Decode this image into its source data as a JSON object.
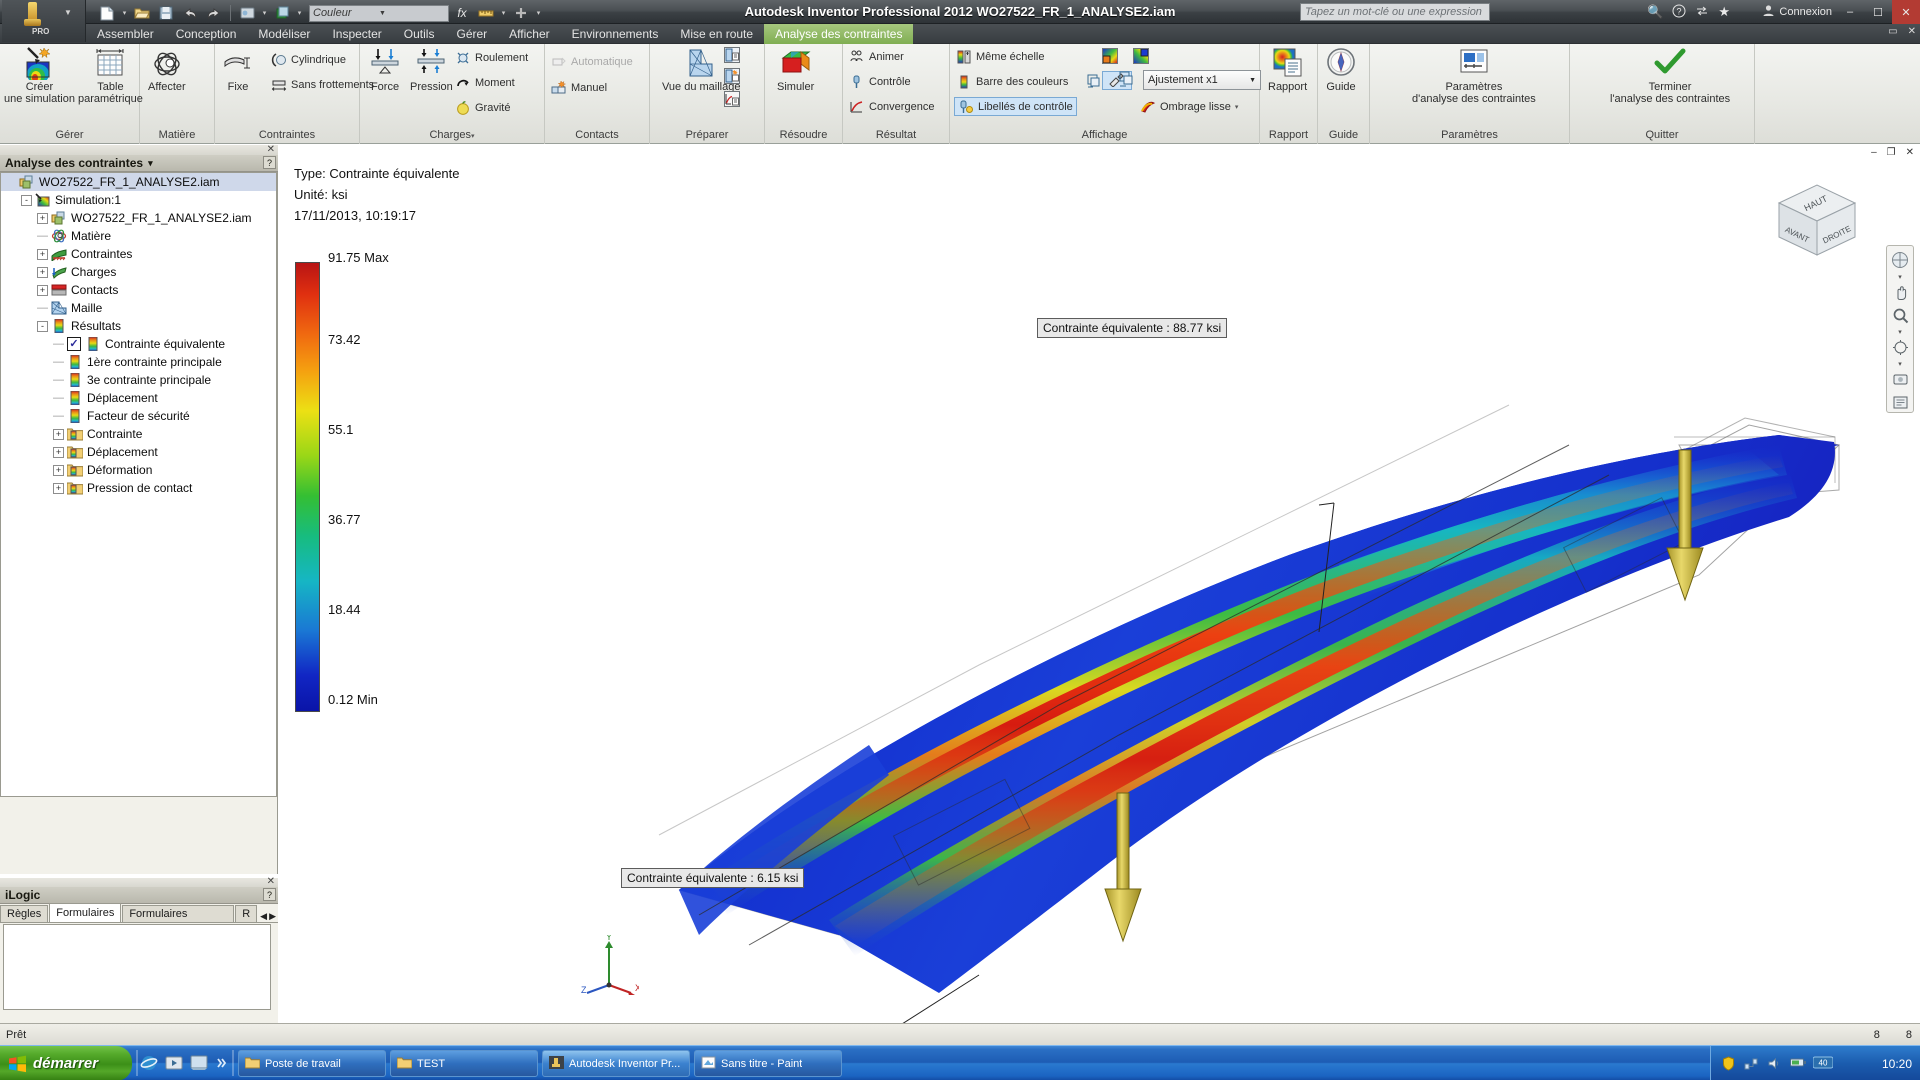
{
  "window": {
    "title": "Autodesk Inventor Professional 2012     WO27522_FR_1_ANALYSE2.iam",
    "search_placeholder": "Tapez un mot-clé ou une expression",
    "signin_label": "Connexion",
    "minimize": "–",
    "maximize": "☐",
    "close": "✕"
  },
  "quick_access": {
    "new_label": "new-file",
    "open_label": "open-file",
    "save_label": "save",
    "undo_label": "undo",
    "redo_label": "redo",
    "color_value": "Couleur",
    "fx_label": "fx",
    "arrow": "▾"
  },
  "tabs": [
    {
      "label": "Assembler",
      "active": false
    },
    {
      "label": "Conception",
      "active": false
    },
    {
      "label": "Modéliser",
      "active": false
    },
    {
      "label": "Inspecter",
      "active": false
    },
    {
      "label": "Outils",
      "active": false
    },
    {
      "label": "Gérer",
      "active": false
    },
    {
      "label": "Afficher",
      "active": false
    },
    {
      "label": "Environnements",
      "active": false
    },
    {
      "label": "Mise en route",
      "active": false
    },
    {
      "label": "Analyse des contraintes",
      "active": true
    }
  ],
  "ribbon": {
    "panels": [
      {
        "label": "Gérer"
      },
      {
        "label": "Matière"
      },
      {
        "label": "Contraintes"
      },
      {
        "label": "Charges"
      },
      {
        "label": "Contacts"
      },
      {
        "label": "Préparer"
      },
      {
        "label": "Résoudre"
      },
      {
        "label": "Résultat"
      },
      {
        "label": "Affichage"
      },
      {
        "label": "Rapport"
      },
      {
        "label": "Guide"
      },
      {
        "label": "Paramètres"
      },
      {
        "label": "Quitter"
      }
    ],
    "buttons": {
      "creer_simulation": "Créer\nune simulation",
      "table_parametrique": "Table\nparamétrique",
      "affecter": "Affecter",
      "fixe": "Fixe",
      "cylindrique": "Cylindrique",
      "sans_frottements": "Sans frottements",
      "force": "Force",
      "pression": "Pression",
      "roulement": "Roulement",
      "moment": "Moment",
      "gravite": "Gravité",
      "automatique": "Automatique",
      "manuel": "Manuel",
      "vue_maillage": "Vue du maillage",
      "simuler": "Simuler",
      "animer": "Animer",
      "controle": "Contrôle",
      "convergence": "Convergence",
      "meme_echelle": "Même échelle",
      "barre_couleurs": "Barre des couleurs",
      "libelles_controle": "Libellés de contrôle",
      "ombrage_lisse": "Ombrage lisse",
      "ajustement": "Ajustement x1",
      "rapport": "Rapport",
      "guide": "Guide",
      "parametres": "Paramètres\nd'analyse des contraintes",
      "terminer": "Terminer\nl'analyse des contraintes"
    },
    "charges_caret": "▾",
    "ombrage_caret": "▾"
  },
  "browser": {
    "title": "Analyse des contraintes",
    "title_caret": "▾",
    "help_glyph": "?",
    "close_glyph": "✕",
    "tree": [
      {
        "label": "WO27522_FR_1_ANALYSE2.iam",
        "depth": 0,
        "icon": "assembly-icon",
        "expander": "",
        "selected": true
      },
      {
        "label": "Simulation:1",
        "depth": 1,
        "icon": "simulation-icon",
        "expander": "-"
      },
      {
        "label": "WO27522_FR_1_ANALYSE2.iam",
        "depth": 2,
        "icon": "assembly-icon",
        "expander": "+"
      },
      {
        "label": "Matière",
        "depth": 2,
        "icon": "material-icon",
        "expander": ""
      },
      {
        "label": "Contraintes",
        "depth": 2,
        "icon": "constraints-icon",
        "expander": "+"
      },
      {
        "label": "Charges",
        "depth": 2,
        "icon": "loads-icon",
        "expander": "+"
      },
      {
        "label": "Contacts",
        "depth": 2,
        "icon": "contacts-icon",
        "expander": "+"
      },
      {
        "label": "Maille",
        "depth": 2,
        "icon": "mesh-icon",
        "expander": ""
      },
      {
        "label": "Résultats",
        "depth": 2,
        "icon": "results-icon",
        "expander": "-"
      },
      {
        "label": "Contrainte équivalente",
        "depth": 3,
        "icon": "result-bar-icon",
        "expander": "",
        "checked": true
      },
      {
        "label": "1ère contrainte principale",
        "depth": 3,
        "icon": "result-bar-icon",
        "expander": ""
      },
      {
        "label": "3e contrainte principale",
        "depth": 3,
        "icon": "result-bar-icon",
        "expander": ""
      },
      {
        "label": "Déplacement",
        "depth": 3,
        "icon": "result-bar-icon",
        "expander": ""
      },
      {
        "label": "Facteur de sécurité",
        "depth": 3,
        "icon": "result-bar-icon",
        "expander": ""
      },
      {
        "label": "Contrainte",
        "depth": 3,
        "icon": "folder-result-icon",
        "expander": "+"
      },
      {
        "label": "Déplacement",
        "depth": 3,
        "icon": "folder-result-icon",
        "expander": "+"
      },
      {
        "label": "Déformation",
        "depth": 3,
        "icon": "folder-result-icon",
        "expander": "+"
      },
      {
        "label": "Pression de contact",
        "depth": 3,
        "icon": "folder-result-icon",
        "expander": "+"
      }
    ]
  },
  "ilogic": {
    "title": "iLogic",
    "help_glyph": "?",
    "close_glyph": "✕",
    "tabs": [
      {
        "label": "Règles",
        "active": false
      },
      {
        "label": "Formulaires",
        "active": true
      },
      {
        "label": "Formulaires globaux",
        "active": false
      },
      {
        "label": "R",
        "active": false
      }
    ],
    "nav_prev": "◀",
    "nav_next": "▶"
  },
  "viewport": {
    "info": {
      "type": "Type: Contrainte équivalente",
      "unit": "Unité: ksi",
      "datetime": "17/11/2013, 10:19:17"
    },
    "legend": {
      "max_label": "91.75 Max",
      "min_label": "0.12 Min",
      "ticks": [
        "73.42",
        "55.1",
        "36.77",
        "18.44"
      ]
    },
    "annotations": [
      {
        "text": "Contrainte équivalente : 88.77 ksi"
      },
      {
        "text": "Contrainte équivalente : 6.15 ksi"
      }
    ],
    "axis": {
      "x": "X",
      "y": "Y",
      "z": "Z"
    },
    "viewcube": {
      "top": "HAUT",
      "front": "AVANT",
      "right": "DROITE"
    },
    "doc_min": "–",
    "doc_max": "❐",
    "doc_close": "✕"
  },
  "statusbar": {
    "message": "Prêt",
    "value_left": "8",
    "value_right": "8"
  },
  "taskbar": {
    "start_label": "démarrer",
    "items": [
      {
        "label": "Poste de travail",
        "icon": "folder-icon",
        "active": false
      },
      {
        "label": "TEST",
        "icon": "folder-icon",
        "active": false
      },
      {
        "label": "Autodesk Inventor Pr...",
        "icon": "inventor-icon",
        "active": true
      },
      {
        "label": "Sans titre - Paint",
        "icon": "paint-icon",
        "active": false
      }
    ],
    "clock": "10:20",
    "tray_badge": "40"
  },
  "chart_data": {
    "type": "heatmap",
    "title": "Contrainte équivalente",
    "unit": "ksi",
    "legend_values": [
      91.75,
      73.42,
      55.1,
      36.77,
      18.44,
      0.12
    ],
    "legend_max": 91.75,
    "legend_min": 0.12,
    "probe_points": [
      {
        "label": "Contrainte équivalente : 88.77 ksi",
        "value": 88.77
      },
      {
        "label": "Contrainte équivalente : 6.15 ksi",
        "value": 6.15
      }
    ],
    "colormap": [
      "#0a14a8",
      "#1a78d4",
      "#16b6c4",
      "#34bf33",
      "#ece014",
      "#f06a10",
      "#b81414"
    ]
  }
}
